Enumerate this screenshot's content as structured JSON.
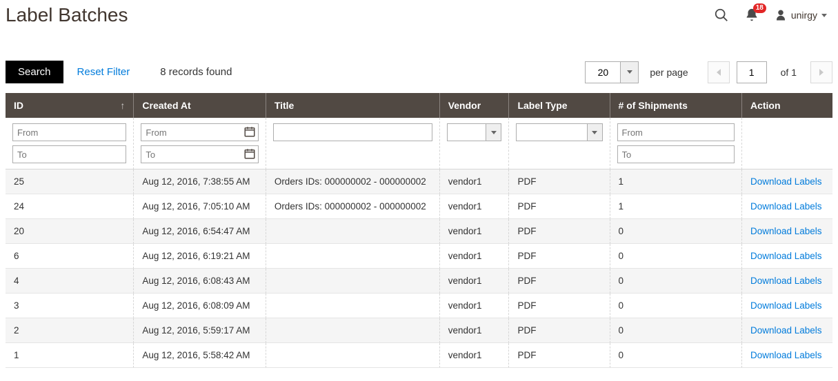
{
  "header": {
    "title": "Label Batches",
    "notification_count": "18",
    "username": "unirgy"
  },
  "toolbar": {
    "search_label": "Search",
    "reset_label": "Reset Filter",
    "records_found": "8 records found",
    "page_size": "20",
    "per_page_label": "per page",
    "current_page": "1",
    "total_pages": "of 1"
  },
  "columns": {
    "id": "ID",
    "created": "Created At",
    "title": "Title",
    "vendor": "Vendor",
    "type": "Label Type",
    "shipments": "# of Shipments",
    "action": "Action"
  },
  "filters": {
    "from": "From",
    "to": "To"
  },
  "rows": [
    {
      "id": "25",
      "created": "Aug 12, 2016, 7:38:55 AM",
      "title": "Orders IDs: 000000002 - 000000002",
      "vendor": "vendor1",
      "type": "PDF",
      "shipments": "1",
      "action": "Download Labels"
    },
    {
      "id": "24",
      "created": "Aug 12, 2016, 7:05:10 AM",
      "title": "Orders IDs: 000000002 - 000000002",
      "vendor": "vendor1",
      "type": "PDF",
      "shipments": "1",
      "action": "Download Labels"
    },
    {
      "id": "20",
      "created": "Aug 12, 2016, 6:54:47 AM",
      "title": "",
      "vendor": "vendor1",
      "type": "PDF",
      "shipments": "0",
      "action": "Download Labels"
    },
    {
      "id": "6",
      "created": "Aug 12, 2016, 6:19:21 AM",
      "title": "",
      "vendor": "vendor1",
      "type": "PDF",
      "shipments": "0",
      "action": "Download Labels"
    },
    {
      "id": "4",
      "created": "Aug 12, 2016, 6:08:43 AM",
      "title": "",
      "vendor": "vendor1",
      "type": "PDF",
      "shipments": "0",
      "action": "Download Labels"
    },
    {
      "id": "3",
      "created": "Aug 12, 2016, 6:08:09 AM",
      "title": "",
      "vendor": "vendor1",
      "type": "PDF",
      "shipments": "0",
      "action": "Download Labels"
    },
    {
      "id": "2",
      "created": "Aug 12, 2016, 5:59:17 AM",
      "title": "",
      "vendor": "vendor1",
      "type": "PDF",
      "shipments": "0",
      "action": "Download Labels"
    },
    {
      "id": "1",
      "created": "Aug 12, 2016, 5:58:42 AM",
      "title": "",
      "vendor": "vendor1",
      "type": "PDF",
      "shipments": "0",
      "action": "Download Labels"
    }
  ]
}
